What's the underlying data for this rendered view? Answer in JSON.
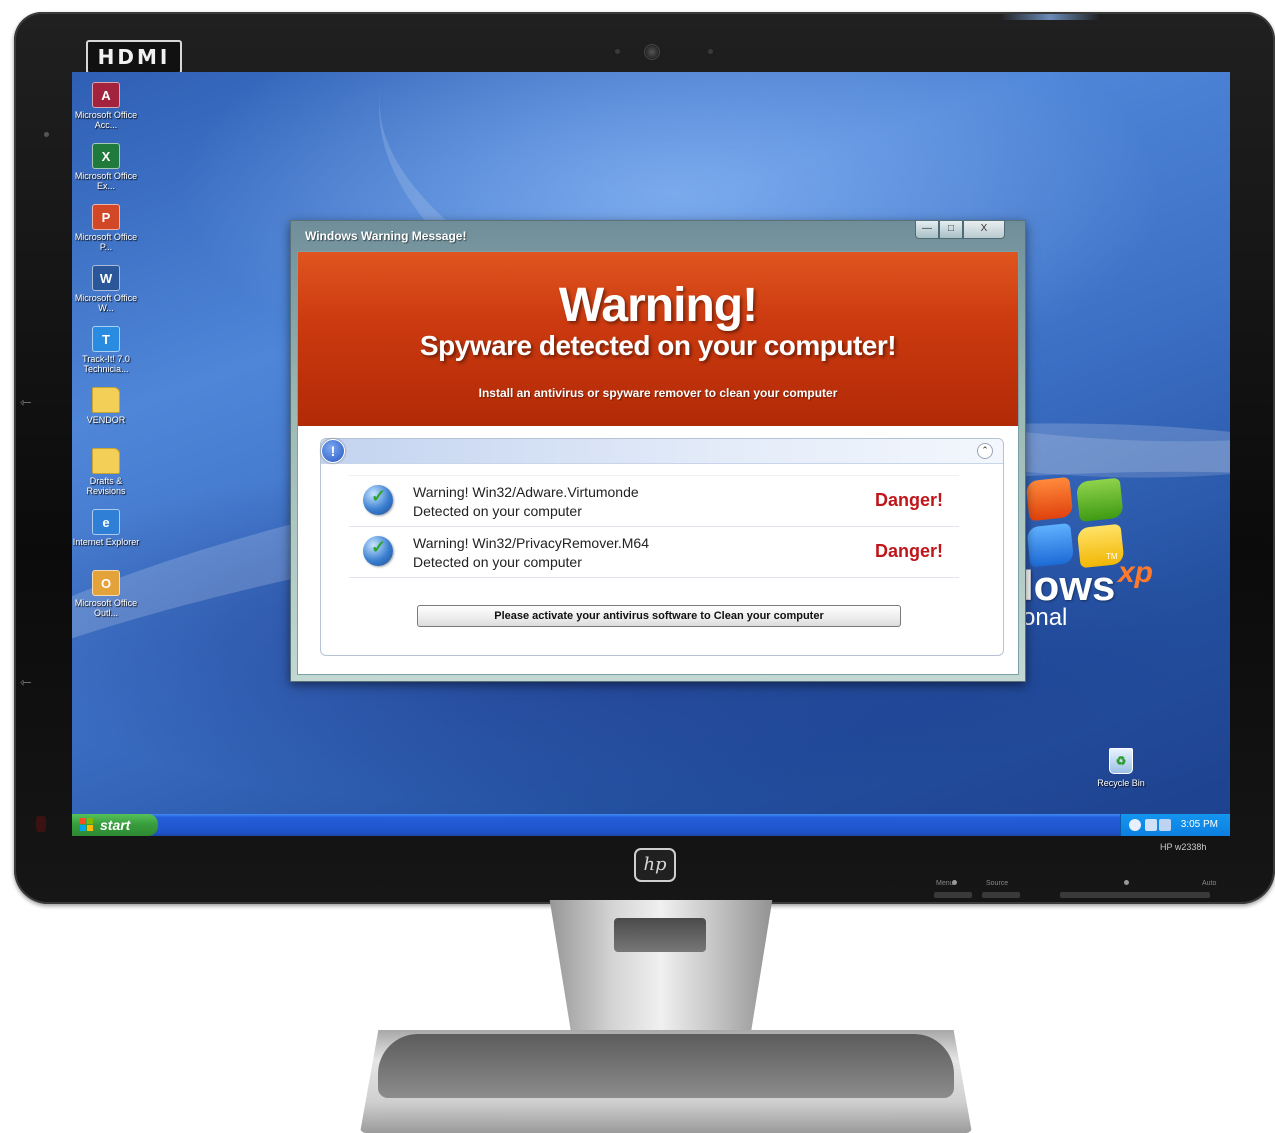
{
  "monitor": {
    "hdmi_label": "HDMI",
    "brand_label": "hp",
    "model_label": "HP w2338h",
    "button_labels": [
      "Menu",
      "Source",
      "Auto"
    ]
  },
  "desktop": {
    "icons": [
      {
        "label": "Microsoft Office Acc...",
        "icon": "access-icon",
        "glyph": "A",
        "color": "#a3223d"
      },
      {
        "label": "Microsoft Office Ex...",
        "icon": "excel-icon",
        "glyph": "X",
        "color": "#1f7a3c"
      },
      {
        "label": "Microsoft Office P...",
        "icon": "powerpoint-icon",
        "glyph": "P",
        "color": "#d24726"
      },
      {
        "label": "Microsoft Office W...",
        "icon": "word-icon",
        "glyph": "W",
        "color": "#2b579a"
      },
      {
        "label": "Track-It! 7.0 Technicia...",
        "icon": "trackit-icon",
        "glyph": "T",
        "color": "#2a8ce0"
      },
      {
        "label": "VENDOR",
        "icon": "folder-icon",
        "glyph": "",
        "color": "#f3cf57"
      },
      {
        "label": "Drafts & Revisions",
        "icon": "folder-icon",
        "glyph": "",
        "color": "#f3cf57"
      },
      {
        "label": "Internet Explorer",
        "icon": "internet-explorer-icon",
        "glyph": "e",
        "color": "#2f7fd6"
      },
      {
        "label": "Microsoft Office Outl...",
        "icon": "outlook-icon",
        "glyph": "O",
        "color": "#e4a23a"
      }
    ],
    "recycle_bin_label": "Recycle Bin",
    "wallpaper_word": "lows",
    "wallpaper_sup": "xp",
    "wallpaper_tm": "TM",
    "wallpaper_sub": "onal"
  },
  "taskbar": {
    "start_label": "start",
    "clock": "3:05 PM"
  },
  "dialog": {
    "title": "Windows Warning Message!",
    "controls": {
      "minimize": "—",
      "maximize": "□",
      "close": "X"
    },
    "heading": "Warning!",
    "subheading": "Spyware detected on your computer!",
    "instruction": "Install an antivirus or spyware remover to clean your computer",
    "info_glyph": "!",
    "collapse_glyph": "⌃",
    "threats": [
      {
        "name": "Warning! Win32/Adware.Virtumonde",
        "detail": "Detected on your computer",
        "status": "Danger!"
      },
      {
        "name": "Warning! Win32/PrivacyRemover.M64",
        "detail": "Detected on your computer",
        "status": "Danger!"
      }
    ],
    "activate_button": "Please activate your antivirus software to Clean your computer"
  },
  "colors": {
    "banner": "#cc3a10",
    "danger_text": "#c0151a",
    "taskbar": "#245edb",
    "start_button": "#379b3c"
  }
}
